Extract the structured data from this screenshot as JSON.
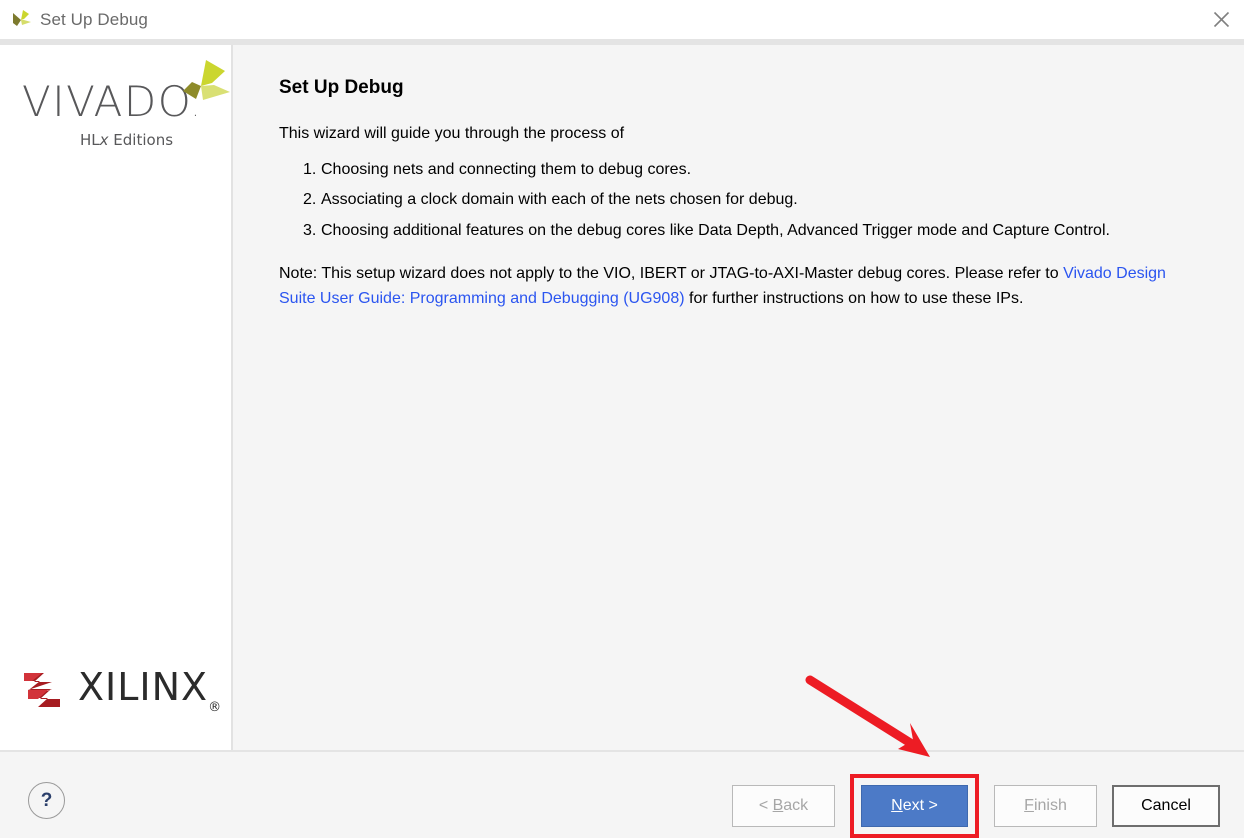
{
  "window": {
    "title": "Set Up Debug",
    "icon": "vivado-logo-icon",
    "close_label": "✕"
  },
  "sidebar": {
    "vivado_logo": {
      "wordmark": "VIVADO",
      "registered_dot": ".",
      "tagline_prefix": "HL",
      "tagline_italic": "x",
      "tagline_suffix": " Editions"
    },
    "xilinx_logo": {
      "wordmark": "XILINX",
      "registered": "®"
    }
  },
  "main": {
    "heading": "Set Up Debug",
    "intro": "This wizard will guide you through the process of",
    "steps": [
      {
        "num": "1.",
        "text": "Choosing nets and connecting them to debug cores."
      },
      {
        "num": "2.",
        "text": "Associating a clock domain with each of the nets chosen for debug."
      },
      {
        "num": "3.",
        "text": "Choosing additional features on the debug cores like Data Depth, Advanced Trigger mode and Capture Control."
      }
    ],
    "note": {
      "before_link": "Note: This setup wizard does not apply to the VIO, IBERT or JTAG-to-AXI-Master debug cores. Please refer to ",
      "link_text": "Vivado Design Suite User Guide: Programming and Debugging (UG908)",
      "after_link": " for further instructions on how to use these IPs."
    }
  },
  "footer": {
    "help_label": "?",
    "buttons": [
      {
        "id": "back",
        "mnemonic_before": "< ",
        "mnemonic": "B",
        "mnemonic_after": "ack",
        "state": "disabled"
      },
      {
        "id": "next",
        "mnemonic_before": "",
        "mnemonic": "N",
        "mnemonic_after": "ext >",
        "state": "primary"
      },
      {
        "id": "finish",
        "mnemonic_before": "",
        "mnemonic": "F",
        "mnemonic_after": "inish",
        "state": "disabled"
      },
      {
        "id": "cancel",
        "mnemonic_before": "",
        "mnemonic": "",
        "mnemonic_after": "Cancel",
        "state": "default"
      }
    ]
  },
  "annotations": {
    "arrow_color": "#ed1c24",
    "highlight_color": "#ed1c24",
    "highlight_target": "next-button"
  },
  "colors": {
    "link": "#2b55f0",
    "primary_button": "#4c7ac7",
    "content_background": "#f5f5f5",
    "sidebar_background": "#ffffff",
    "title_text": "#6a6a6a",
    "xilinx_red": "#a61c21",
    "vivado_green": "#c8d123"
  }
}
